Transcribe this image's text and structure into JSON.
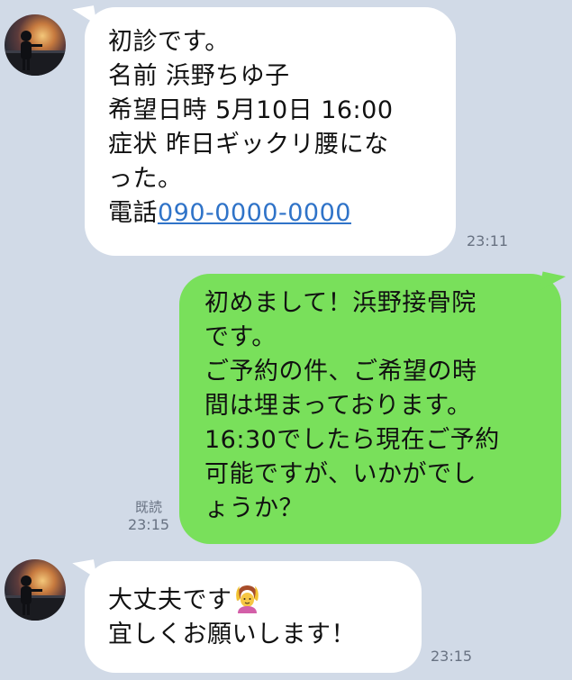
{
  "messages": [
    {
      "from": "them",
      "lines": [
        "初診です。",
        "名前 浜野ちゆ子",
        "希望日時 5月10日 16:00",
        "症状 昨日ギックリ腰にな",
        "った。"
      ],
      "phone_prefix": "電話",
      "phone_link": "090-0000-0000",
      "time": "23:11"
    },
    {
      "from": "me",
      "lines": [
        "初めまして！浜野接骨院",
        "です。",
        "ご予約の件、ご希望の時",
        "間は埋まっております。",
        "16:30でしたら現在ご予約",
        "可能ですが、いかがでし",
        "ょうか？"
      ],
      "read_status": "既読",
      "time": "23:15"
    },
    {
      "from": "them",
      "lines": [
        "大丈夫です",
        "宜しくお願いします！"
      ],
      "emoji": "person-gesturing-ok-emoji",
      "time": "23:15"
    }
  ],
  "colors": {
    "background": "#d1dae7",
    "incoming_bubble": "#ffffff",
    "outgoing_bubble": "#79e05b",
    "link": "#2f73c8",
    "meta_text": "#687282"
  }
}
